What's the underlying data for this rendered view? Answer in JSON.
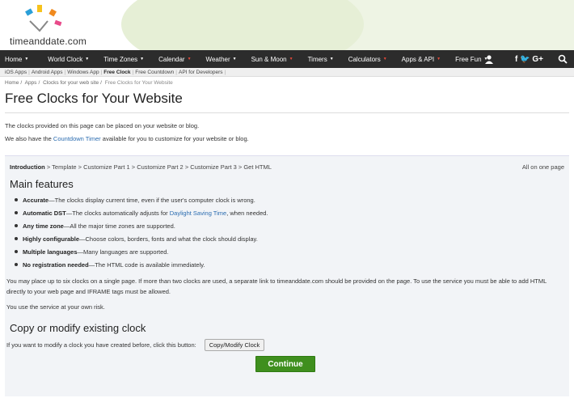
{
  "brand": {
    "name": "timeanddate",
    "suffix": ".com"
  },
  "nav": {
    "items": [
      {
        "label": "Home"
      },
      {
        "label": "World Clock"
      },
      {
        "label": "Time Zones"
      },
      {
        "label": "Calendar"
      },
      {
        "label": "Weather"
      },
      {
        "label": "Sun & Moon"
      },
      {
        "label": "Timers"
      },
      {
        "label": "Calculators"
      },
      {
        "label": "Apps & API"
      },
      {
        "label": "Free Fun"
      }
    ],
    "social_label": "f 🐦 G+"
  },
  "subnav": {
    "items": [
      "iOS Apps",
      "Android Apps",
      "Windows App",
      "Free Clock",
      "Free Countdown",
      "API for Developers"
    ],
    "active": "Free Clock"
  },
  "breadcrumb": [
    "Home",
    "Apps",
    "Clocks for your web site",
    "Free Clocks for Your Website"
  ],
  "page": {
    "title": "Free Clocks for Your Website",
    "intro1": "The clocks provided on this page can be placed on your website or blog.",
    "intro2_prefix": "We also have the ",
    "intro2_link": "Countdown Timer",
    "intro2_suffix": " available for you to customize for your website or blog."
  },
  "steps": {
    "current": "Introduction",
    "rest": " > Template > Customize Part 1 > Customize Part 2 > Customize Part 3 > Get HTML",
    "all_on_one": "All on one page"
  },
  "features": {
    "heading": "Main features",
    "items": [
      {
        "bold": "Accurate",
        "text": "—The clocks display current time, even if the user's computer clock is wrong."
      },
      {
        "bold": "Automatic DST",
        "text": "—The clocks automatically adjusts for ",
        "link": "Daylight Saving Time",
        "after": ", when needed."
      },
      {
        "bold": "Any time zone",
        "text": "—All the major time zones are supported."
      },
      {
        "bold": "Highly configurable",
        "text": "—Choose colors, borders, fonts and what the clock should display."
      },
      {
        "bold": "Multiple languages",
        "text": "—Many languages are supported."
      },
      {
        "bold": "No registration needed",
        "text": "—The HTML code is available immediately."
      }
    ]
  },
  "notes": {
    "limit": "You may place up to six clocks on a single page. If more than two clocks are used, a separate link to timeanddate.com should be provided on the page. To use the service you must be able to add HTML directly to your web page and IFRAME tags must be allowed.",
    "risk": "You use the service at your own risk."
  },
  "copy": {
    "heading": "Copy or modify existing clock",
    "text": "If you want to modify a clock you have created before, click this button:",
    "button": "Copy/Modify Clock"
  },
  "continue_label": "Continue",
  "colors": {
    "nav_bg": "#2c2c2c",
    "accent_green": "#3f8f1e",
    "link": "#2b6cb0"
  }
}
